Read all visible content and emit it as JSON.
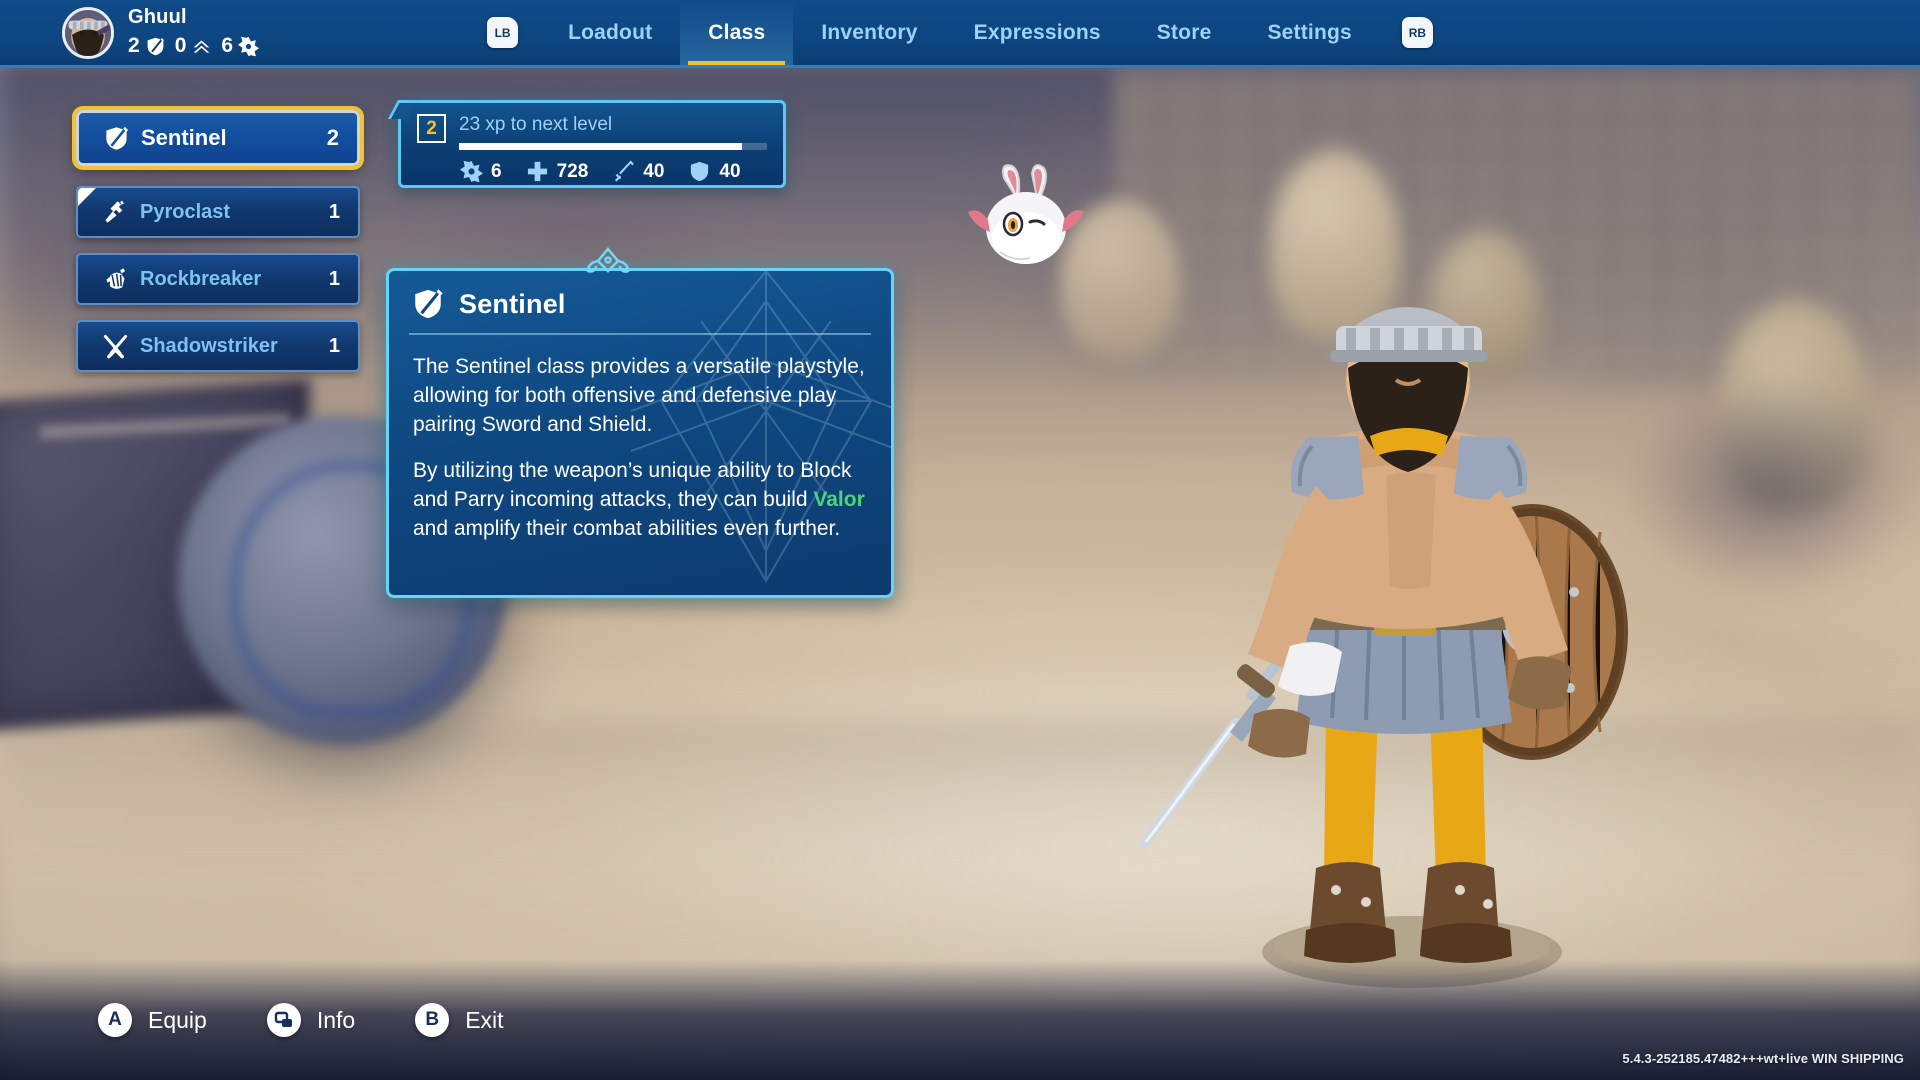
{
  "profile": {
    "name": "Ghuul",
    "avatar_icon": "player-portrait",
    "stats": [
      {
        "icon": "shield-sword-icon",
        "value": "2"
      },
      {
        "icon": "chevron-rank-icon",
        "value": "0"
      },
      {
        "icon": "star-currency-icon",
        "value": "6"
      }
    ]
  },
  "nav": {
    "left_bumper": "LB",
    "right_bumper": "RB",
    "tabs": [
      {
        "label": "Loadout",
        "active": false
      },
      {
        "label": "Class",
        "active": true
      },
      {
        "label": "Inventory",
        "active": false
      },
      {
        "label": "Expressions",
        "active": false
      },
      {
        "label": "Store",
        "active": false
      },
      {
        "label": "Settings",
        "active": false
      }
    ],
    "active_underline_color": "#f2c230"
  },
  "class_list": [
    {
      "name": "Sentinel",
      "level": "2",
      "icon": "shield-sword-icon",
      "selected": true
    },
    {
      "name": "Pyroclast",
      "level": "1",
      "icon": "hammer-icon",
      "selected": false
    },
    {
      "name": "Rockbreaker",
      "level": "1",
      "icon": "gauntlet-fist-icon",
      "selected": false
    },
    {
      "name": "Shadowstriker",
      "level": "1",
      "icon": "twin-daggers-icon",
      "selected": false
    }
  ],
  "xp_panel": {
    "level": "2",
    "xp_text": "23 xp to next level",
    "progress_percent": 92,
    "stats": [
      {
        "icon": "star-currency-icon",
        "value": "6"
      },
      {
        "icon": "health-cross-icon",
        "value": "728"
      },
      {
        "icon": "sword-icon",
        "value": "40"
      },
      {
        "icon": "shield-icon",
        "value": "40"
      }
    ]
  },
  "description": {
    "title": "Sentinel",
    "icon": "shield-sword-icon",
    "paragraph1": "The Sentinel class provides a versatile playstyle, allowing for both offensive and defensive play pairing Sword and Shield.",
    "paragraph2_before": "By utilizing the weapon’s unique ability to Block and Parry incoming attacks, they can build ",
    "paragraph2_highlight": "Valor",
    "paragraph2_after": " and amplify their combat abilities even further.",
    "highlight_color": "#4dd37a"
  },
  "bottom_prompts": [
    {
      "glyph": "A",
      "glyph_type": "letter",
      "label": "Equip"
    },
    {
      "glyph": "windows-icon",
      "glyph_type": "icon",
      "label": "Info"
    },
    {
      "glyph": "B",
      "glyph_type": "letter",
      "label": "Exit"
    }
  ],
  "version": "5.4.3-252185.47482+++wt+live WIN  SHIPPING"
}
